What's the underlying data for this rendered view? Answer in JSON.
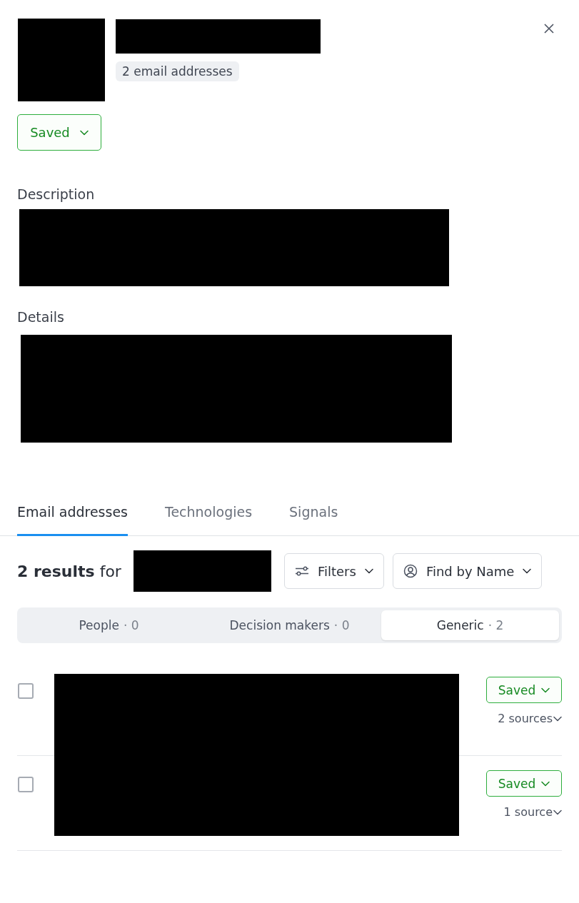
{
  "header": {
    "badge": "2 email addresses",
    "status_button": "Saved"
  },
  "sections": [
    {
      "label": "Description",
      "kind": "short"
    },
    {
      "label": "Details",
      "kind": "tall"
    }
  ],
  "tabs": [
    {
      "label": "Email addresses",
      "selected": true
    },
    {
      "label": "Technologies",
      "selected": false
    },
    {
      "label": "Signals",
      "selected": false
    }
  ],
  "results": {
    "summary": "**2 results** for",
    "filters_button": "Filters",
    "find_button": "Find by Name"
  },
  "segments": [
    {
      "label": "People",
      "count": "· 0",
      "selected": false
    },
    {
      "label": "Decision makers",
      "count": "· 0",
      "selected": false
    },
    {
      "label": "Generic",
      "count": "· 2",
      "selected": true
    }
  ],
  "rows": [
    {
      "checked": false,
      "status": "Saved",
      "sources": "2 sources"
    },
    {
      "checked": false,
      "status": "Saved",
      "sources": "1 source"
    }
  ]
}
